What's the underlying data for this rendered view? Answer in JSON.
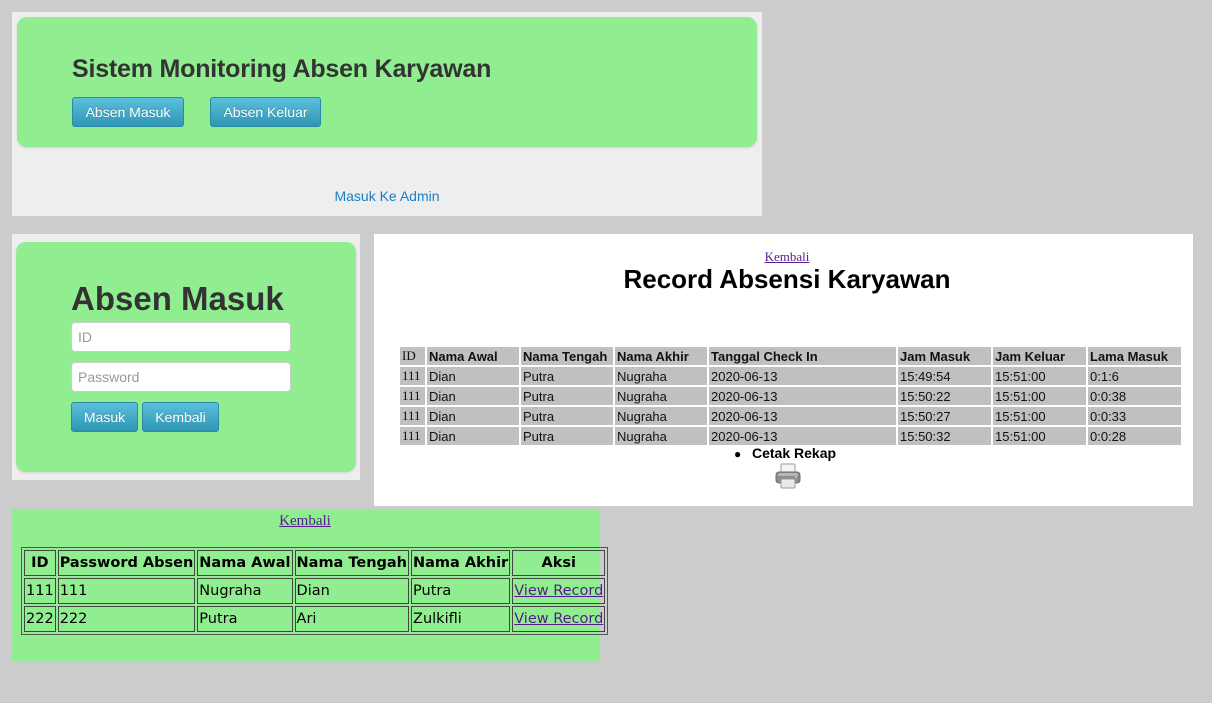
{
  "home": {
    "title": "Sistem Monitoring Absen Karyawan",
    "buttons": {
      "absen_masuk": "Absen Masuk",
      "absen_keluar": "Absen Keluar"
    },
    "admin_link": "Masuk Ke Admin",
    "colors": {
      "panel_bg": "#90ee90",
      "button": "#2f96b4",
      "link": "#1a7fc7"
    }
  },
  "form": {
    "title": "Absen Masuk",
    "id_field": {
      "value": "",
      "placeholder": "ID"
    },
    "password_field": {
      "value": "",
      "placeholder": "Password"
    },
    "buttons": {
      "masuk": "Masuk",
      "kembali": "Kembali"
    }
  },
  "record": {
    "back_link": "Kembali",
    "title": "Record Absensi Karyawan",
    "columns": [
      "ID",
      "Nama Awal",
      "Nama Tengah",
      "Nama Akhir",
      "Tanggal Check In",
      "Jam Masuk",
      "Jam Keluar",
      "Lama Masuk"
    ],
    "rows": [
      [
        "111",
        "Dian",
        "Putra",
        "Nugraha",
        "2020-06-13",
        "15:49:54",
        "15:51:00",
        "0:1:6"
      ],
      [
        "111",
        "Dian",
        "Putra",
        "Nugraha",
        "2020-06-13",
        "15:50:22",
        "15:51:00",
        "0:0:38"
      ],
      [
        "111",
        "Dian",
        "Putra",
        "Nugraha",
        "2020-06-13",
        "15:50:27",
        "15:51:00",
        "0:0:33"
      ],
      [
        "111",
        "Dian",
        "Putra",
        "Nugraha",
        "2020-06-13",
        "15:50:32",
        "15:51:00",
        "0:0:28"
      ]
    ],
    "print_label": "Cetak Rekap",
    "print_icon": "printer-icon"
  },
  "admin": {
    "back_link": "Kembali",
    "columns": [
      "ID",
      "Password Absen",
      "Nama Awal",
      "Nama Tengah",
      "Nama Akhir",
      "Aksi"
    ],
    "rows": [
      {
        "cells": [
          "111",
          "111",
          "Nugraha",
          "Dian",
          "Putra"
        ],
        "action": "View Record"
      },
      {
        "cells": [
          "222",
          "222",
          "Putra",
          "Ari",
          "Zulkifli"
        ],
        "action": "View Record"
      }
    ]
  }
}
